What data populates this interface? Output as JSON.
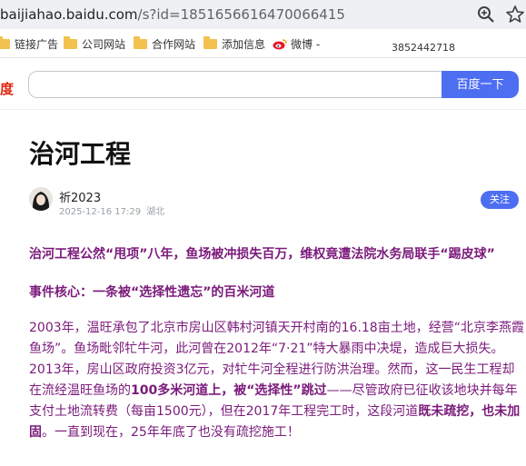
{
  "address_bar": {
    "host": "baijiahao.baidu.com",
    "path": "/s?id=1851656616470066415"
  },
  "bookmarks": [
    {
      "label": "链接广告",
      "icon": "folder-icon"
    },
    {
      "label": "公司网站",
      "icon": "folder-icon"
    },
    {
      "label": "合作网站",
      "icon": "folder-icon"
    },
    {
      "label": "添加信息",
      "icon": "folder-icon"
    },
    {
      "label": "微博 -",
      "icon": "weibo-icon"
    }
  ],
  "phone_number": "3852442718",
  "search": {
    "brand": "度",
    "button_label": "百度一下",
    "placeholder": ""
  },
  "article": {
    "title": "治河工程",
    "author": "祈2023",
    "date": "2025-12-16 17:29",
    "location": "湖北",
    "follow_label": "关注",
    "headline": "治河工程公然“甩项”八年，鱼场被冲损失百万，维权竟遭法院水务局联手“踢皮球”",
    "core_heading": "事件核心：一条被“选择性遗忘”的百米河道",
    "para1": "2003年，温旺承包了北京市房山区韩村河镇天开村南的16.18亩土地，经营“北京李燕霞鱼场”。鱼场毗邻牤牛河，此河曾在2012年“7·21”特大暴雨中决堤，造成巨大损失。",
    "para2_a": "2013年，房山区政府投资3亿元，对牤牛河全程进行防洪治理。然而，这一民生工程却在流经温旺鱼场的",
    "para2_b": "100多米河道上，被“选择性”跳过",
    "para2_c": "——尽管政府已征收该地块并每年支付土地流转费（每亩1500元），但在2017年工程完工时，这段河道",
    "para2_d": "既未疏挖，也未加固",
    "para2_e": "。一直到现在，25年年底了也没有疏挖施工！"
  },
  "colors": {
    "accent": "#4e6ef2",
    "article_text": "#7b1a7b",
    "brand_red": "#de2910"
  }
}
